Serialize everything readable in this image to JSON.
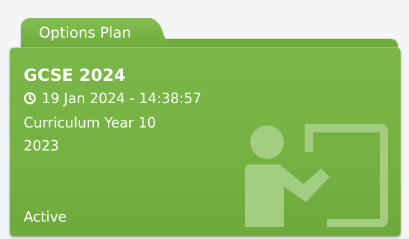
{
  "card": {
    "tab_label": "Options Plan",
    "title": "GCSE 2024",
    "timestamp": "19 Jan 2024 - 14:38:57",
    "curriculum": "Curriculum Year 10",
    "year": "2023",
    "status": "Active"
  },
  "icons": {
    "clock": "clock-icon",
    "teacher": "teacher-board-icon"
  },
  "colors": {
    "card_green": "#75b142",
    "icon_tint": "#a3cd80"
  }
}
